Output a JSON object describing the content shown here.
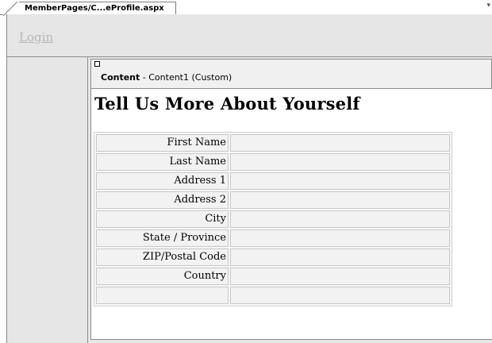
{
  "tab": {
    "label": "MemberPages/C...eProfile.aspx"
  },
  "master": {
    "login_link": "Login"
  },
  "content_panel": {
    "label_bold": "Content",
    "label_rest": " - Content1 (Custom)"
  },
  "page": {
    "title": "Tell Us More About Yourself"
  },
  "form": {
    "rows": [
      {
        "label": "First Name",
        "value": ""
      },
      {
        "label": "Last Name",
        "value": ""
      },
      {
        "label": "Address 1",
        "value": ""
      },
      {
        "label": "Address 2",
        "value": ""
      },
      {
        "label": "City",
        "value": ""
      },
      {
        "label": "State / Province",
        "value": ""
      },
      {
        "label": "ZIP/Postal Code",
        "value": ""
      },
      {
        "label": "Country",
        "value": ""
      },
      {
        "label": "",
        "value": ""
      }
    ]
  }
}
